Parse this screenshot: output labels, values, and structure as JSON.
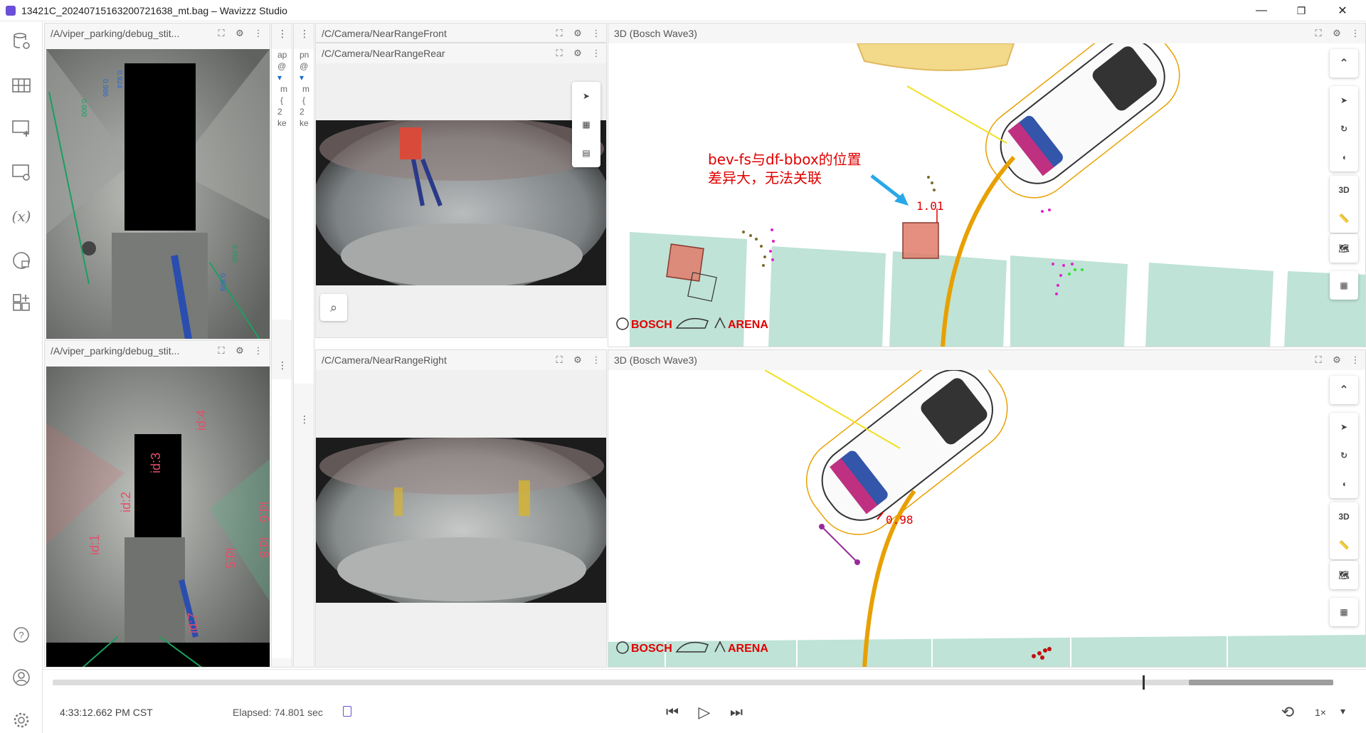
{
  "window": {
    "title": "13421C_20240715163200721638_mt.bag – Wavizzz Studio",
    "minimize": "—",
    "maximize": "❐",
    "close": "✕"
  },
  "sidebar": {
    "items": [
      "data-source-icon",
      "layout-icon",
      "add-panel-icon",
      "panel-settings-icon",
      "variables-icon",
      "extensions-icon",
      "add-extension-icon"
    ],
    "bottom": [
      "help-icon",
      "account-icon",
      "settings-icon"
    ],
    "variables_glyph": "(𝑥)",
    "help_glyph": "?"
  },
  "panels": {
    "debug_top_title": "/A/viper_parking/debug_stit...",
    "debug_bottom_title": "/A/viper_parking/debug_stit...",
    "cam_front_title": "/C/Camera/NearRangeFront",
    "cam_rear_title": "/C/Camera/NearRangeRear",
    "cam_right_title": "/C/Camera/NearRangeRight",
    "scene_top_title": "3D (Bosch Wave3)",
    "scene_bottom_title": "3D (Bosch Wave3)",
    "narrow_col1": [
      "ap",
      "@",
      "▾",
      "m",
      "{",
      "2",
      "ke"
    ],
    "narrow_col2": [
      "pn",
      "@",
      "▾",
      "m",
      "{",
      "2",
      "ke"
    ]
  },
  "icons": {
    "expand": "⛶",
    "gear": "⚙",
    "more": "⋮",
    "pointer": "➤",
    "qr": "▦",
    "film": "▤",
    "search": "⌕",
    "chevron_up": "⌃",
    "rotate": "↻",
    "mouse": "◖",
    "label_3d": "3D",
    "ruler": "📏",
    "map": "🗺",
    "grid": "▦"
  },
  "annotation": {
    "line1": "bev-fs与df-bbox的位置",
    "line2": "差异大，无法关联"
  },
  "scene_top": {
    "value_label": "1.01",
    "brands": [
      "BOSCH",
      "ARENA"
    ]
  },
  "scene_bottom": {
    "value_label": "0.98",
    "brands": [
      "BOSCH",
      "ARENA"
    ]
  },
  "debug_labels_top": [
    "0.924",
    "0.986",
    "0.000",
    "0.000",
    "0.869"
  ],
  "debug_labels_bottom": [
    "id:4",
    "id:3",
    "id:2",
    "id:1",
    "id:8",
    "id:6",
    "id:7",
    "id:5"
  ],
  "playback": {
    "time": "4:33:12.662 PM CST",
    "elapsed": "Elapsed: 74.801 sec",
    "speed": "1×",
    "progress": 0.967,
    "buffered_start": 0.887,
    "skip_back": "⏮",
    "play": "▷",
    "skip_forward": "⏭",
    "loop": "⟲",
    "dropdown": "▾"
  },
  "colors": {
    "accent": "#6b4fd8",
    "annotation": "#e00000",
    "lane": "#e8a000",
    "parking_slot": "#bfe3d6",
    "bbox": "#e07b6a"
  }
}
